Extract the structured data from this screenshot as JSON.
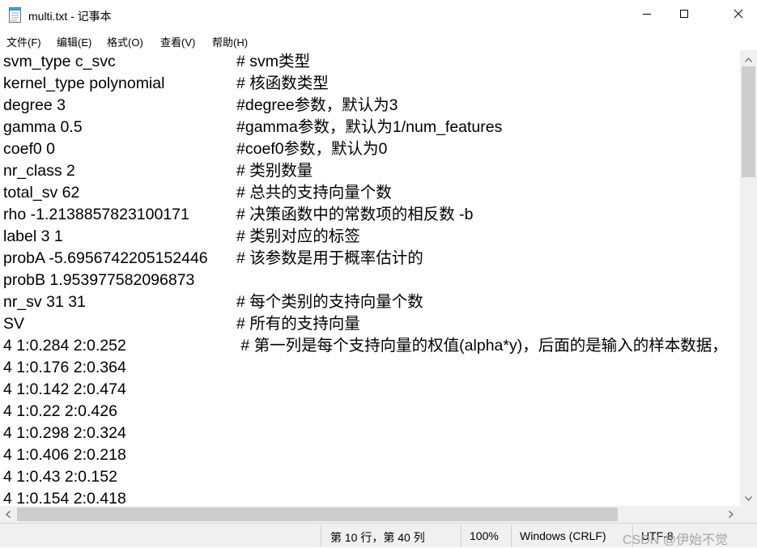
{
  "window": {
    "title": "multi.txt - 记事本"
  },
  "menu": [
    {
      "label": "文件(F)"
    },
    {
      "label": "编辑(E)"
    },
    {
      "label": "格式(O)"
    },
    {
      "label": "查看(V)"
    },
    {
      "label": "帮助(H)"
    }
  ],
  "editor": {
    "lines": [
      {
        "code": "svm_type c_svc",
        "comment": "# svm类型"
      },
      {
        "code": "kernel_type polynomial",
        "comment": "# 核函数类型"
      },
      {
        "code": "degree 3",
        "comment": "#degree参数，默认为3"
      },
      {
        "code": "gamma 0.5",
        "comment": "#gamma参数，默认为1/num_features"
      },
      {
        "code": "coef0 0",
        "comment": "#coef0参数，默认为0"
      },
      {
        "code": "nr_class 2",
        "comment": "# 类别数量"
      },
      {
        "code": "total_sv 62",
        "comment": "# 总共的支持向量个数"
      },
      {
        "code": "rho -1.2138857823100171",
        "comment": "# 决策函数中的常数项的相反数 -b"
      },
      {
        "code": "label 3 1",
        "comment": "# 类别对应的标签"
      },
      {
        "code": "probA -5.6956742205152446",
        "comment": "# 该参数是用于概率估计的"
      },
      {
        "code": "probB 1.953977582096873",
        "comment": ""
      },
      {
        "code": "nr_sv 31 31",
        "comment": "# 每个类别的支持向量个数"
      },
      {
        "code": "SV",
        "comment": "# 所有的支持向量"
      },
      {
        "code": "4 1:0.284 2:0.252",
        "comment": " # 第一列是每个支持向量的权值(alpha*y)，后面的是输入的样本数据，"
      },
      {
        "code": "4 1:0.176 2:0.364",
        "comment": ""
      },
      {
        "code": "4 1:0.142 2:0.474",
        "comment": ""
      },
      {
        "code": "4 1:0.22 2:0.426",
        "comment": ""
      },
      {
        "code": "4 1:0.298 2:0.324",
        "comment": ""
      },
      {
        "code": "4 1:0.406 2:0.218",
        "comment": ""
      },
      {
        "code": "4 1:0.43 2:0.152",
        "comment": ""
      },
      {
        "code": "4 1:0.154 2:0.418",
        "comment": ""
      }
    ]
  },
  "status": {
    "position": "第 10 行，第 40 列",
    "zoom": "100%",
    "line_ending": "Windows (CRLF)",
    "encoding": "UTF-8",
    "watermark": "CSDN @伊始不觉"
  },
  "icons": {
    "app": "notepad-icon",
    "minimize": "minimize-icon",
    "maximize": "maximize-icon",
    "close": "close-icon"
  }
}
